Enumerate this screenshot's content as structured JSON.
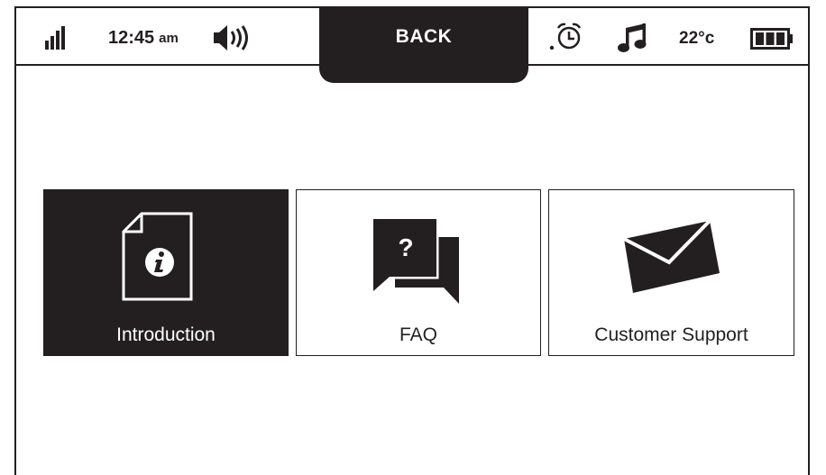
{
  "status_bar": {
    "signal_icon": "signal-bars-icon",
    "time": "12:45",
    "ampm": "am",
    "volume_icon": "speaker-volume-icon",
    "back_label": "BACK",
    "alarm_icon": "alarm-clock-icon",
    "music_icon": "music-note-icon",
    "temperature": "22°c",
    "battery_icon": "battery-full-icon"
  },
  "menu": {
    "tiles": [
      {
        "label": "Introduction",
        "icon": "info-document-icon",
        "selected": true
      },
      {
        "label": "FAQ",
        "icon": "question-chat-icon",
        "selected": false
      },
      {
        "label": "Customer Support",
        "icon": "envelope-icon",
        "selected": false
      }
    ]
  },
  "colors": {
    "foreground": "#231f20",
    "background": "#ffffff",
    "selected_tile_bg": "#231f20",
    "selected_tile_text": "#ffffff"
  }
}
